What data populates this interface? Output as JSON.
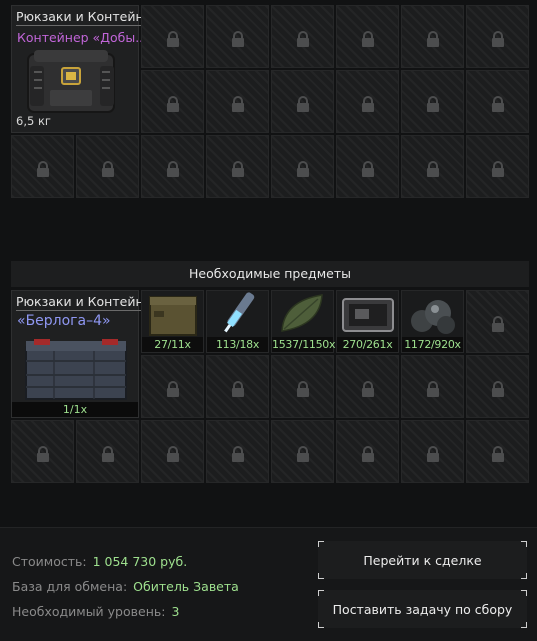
{
  "reward_section": {
    "category": "Рюкзаки и Контейнеры",
    "item_name": "Контейнер «Добы..",
    "weight": "6,5 кг"
  },
  "required_section": {
    "header": "Необходимые предметы",
    "category": "Рюкзаки и Контейнеры",
    "item_name": "«Берлога–4»",
    "item_qty": "1/1x",
    "materials": [
      {
        "name": "ammo-box-icon",
        "qty": "27/11x"
      },
      {
        "name": "syringe-icon",
        "qty": "113/18x"
      },
      {
        "name": "leaf-icon",
        "qty": "1537/1150x"
      },
      {
        "name": "tablet-icon",
        "qty": "270/261x"
      },
      {
        "name": "stones-icon",
        "qty": "1172/920x"
      }
    ]
  },
  "summary": {
    "cost_label": "Стоимость:",
    "cost_value": "1 054 730 руб.",
    "base_label": "База для обмена:",
    "base_value": "Обитель Завета",
    "level_label": "Необходимый уровень:",
    "level_value": "3"
  },
  "buttons": {
    "deal": "Перейти к сделке",
    "assign": "Поставить задачу по сбору"
  },
  "colors": {
    "rarity_purple": "#c165d8",
    "rarity_blue": "#8f97f2",
    "accent_green": "#9ee08e"
  }
}
